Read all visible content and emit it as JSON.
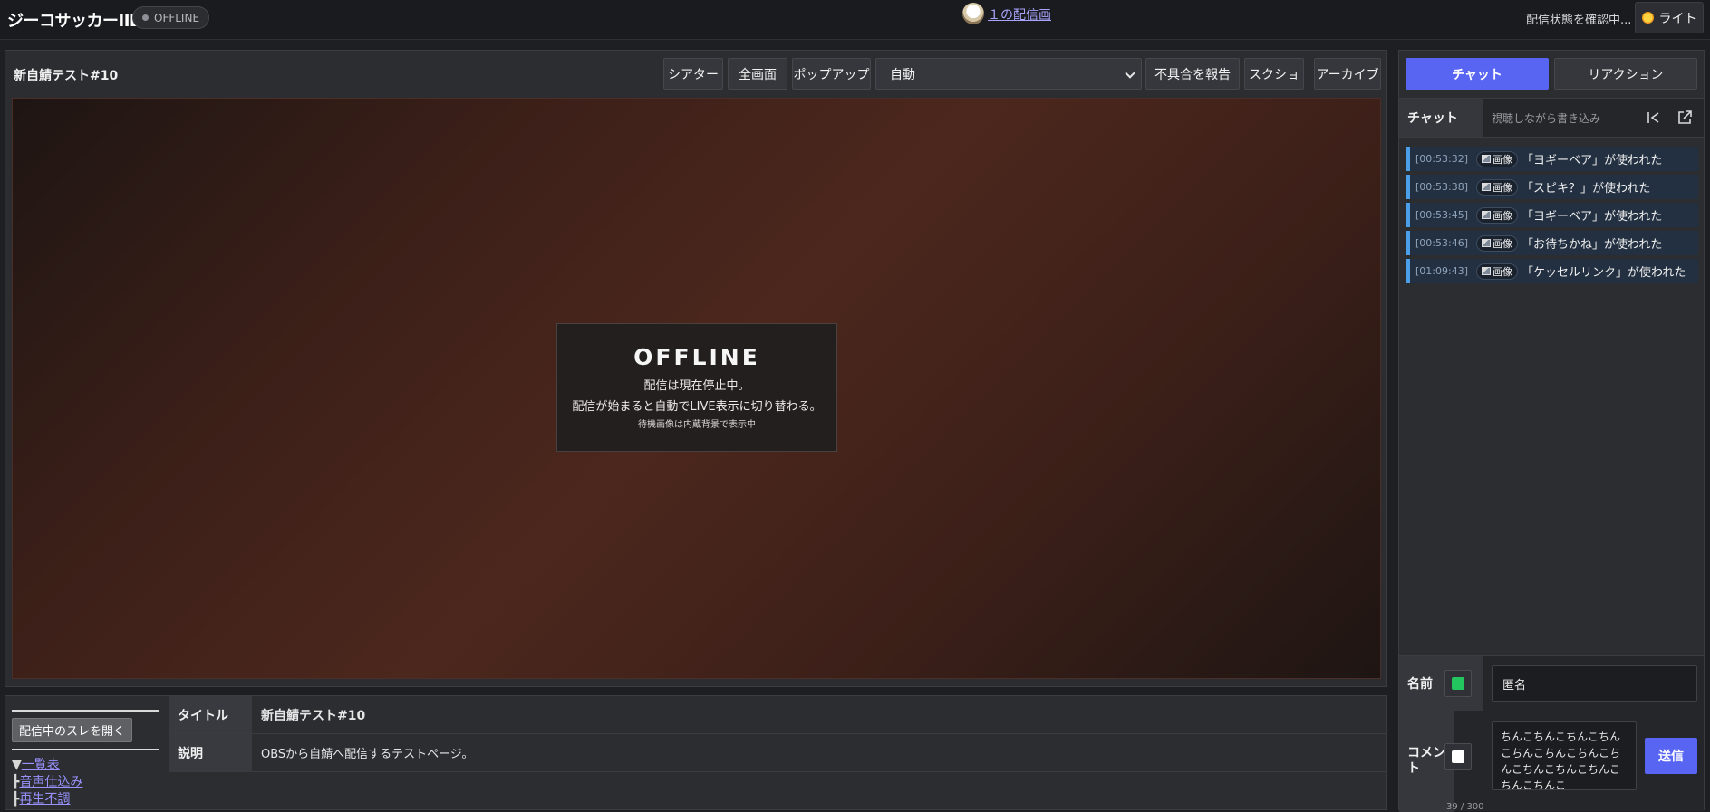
{
  "header": {
    "app_title": "ジーコサッカーIIDX",
    "status_badge": "OFFLINE",
    "center_link": "１の配信画",
    "status_check": "配信状態を確認中...",
    "theme_button": "ライト"
  },
  "player": {
    "stream_title": "新自鯖テスト#10",
    "toolbar": {
      "theater": "シアター",
      "fullscreen": "全画面",
      "popup": "ポップアップ",
      "quality_selected": "自動",
      "report": "不具合を報告",
      "screenshot": "スクショ",
      "archive": "アーカイブ"
    },
    "offline_card": {
      "heading": "OFFLINE",
      "line1": "配信は現在停止中。",
      "line2": "配信が始まると自動でLIVE表示に切り替わる。",
      "note": "待機画像は内蔵背景で表示中"
    }
  },
  "info": {
    "open_thread_button": "配信中のスレを開く",
    "thread_links": [
      {
        "prefix": "▼",
        "label": "一覧表"
      },
      {
        "prefix": "┣",
        "label": "音声仕込み"
      },
      {
        "prefix": "┣",
        "label": "再生不調"
      }
    ],
    "rows": [
      {
        "key": "タイトル",
        "value": "新自鯖テスト#10"
      },
      {
        "key": "説明",
        "value": "OBSから自鯖へ配信するテストページ。"
      }
    ]
  },
  "sidebar": {
    "tabs": {
      "chat": "チャット",
      "reaction": "リアクション"
    },
    "chat_header": {
      "label": "チャット",
      "hint": "視聴しながら書き込み"
    },
    "messages": [
      {
        "time": "[00:53:32]",
        "badge": "画像",
        "text": "「ヨギーベア」が使われた"
      },
      {
        "time": "[00:53:38]",
        "badge": "画像",
        "text": "「スピキ？」が使われた"
      },
      {
        "time": "[00:53:45]",
        "badge": "画像",
        "text": "「ヨギーベア」が使われた"
      },
      {
        "time": "[00:53:46]",
        "badge": "画像",
        "text": "「お待ちかね」が使われた"
      },
      {
        "time": "[01:09:43]",
        "badge": "画像",
        "text": "「ケッセルリンク」が使われた"
      }
    ],
    "form": {
      "name_label": "名前",
      "name_value": "匿名",
      "name_color": "#22c55e",
      "comment_label": "コメント",
      "comment_value": "ちんこちんこちんこちんこちんこちんこちんこちんこちんこちんこちんこちんこちんこ",
      "comment_color": "#ffffff",
      "send_button": "送信",
      "char_count": "39 / 300"
    }
  },
  "colors": {
    "accent": "#5865f2",
    "chat_border": "#4a9fe8",
    "link": "#a8a4ff"
  }
}
